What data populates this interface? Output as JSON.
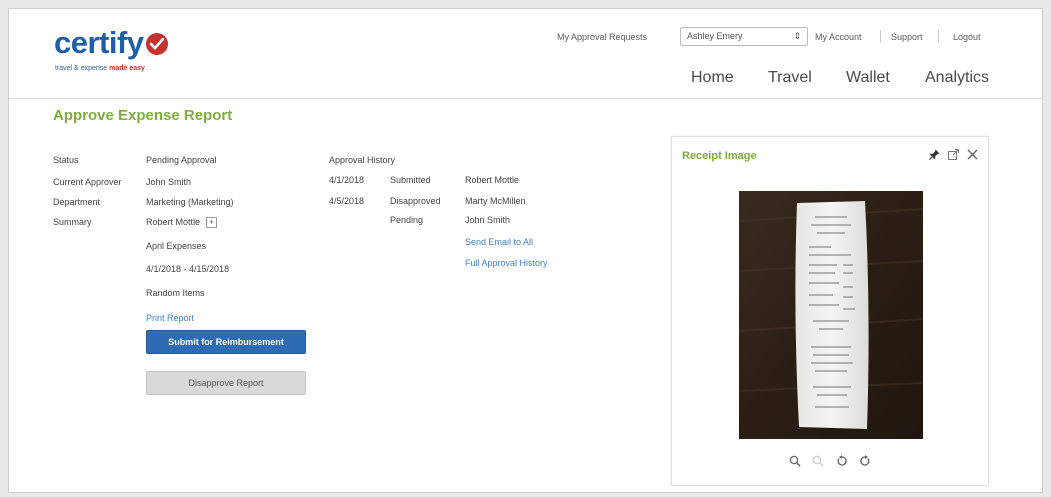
{
  "brand": {
    "name": "certify",
    "tagline_part1": "travel & expense",
    "tagline_part2": "made easy",
    "accent_color": "#c7322f",
    "logo_color": "#1f5fa8"
  },
  "header": {
    "my_approval_requests": "My Approval Requests",
    "user_selected": "Ashley Emery",
    "my_account": "My Account",
    "support": "Support",
    "logout": "Logout"
  },
  "nav": {
    "home": "Home",
    "travel": "Travel",
    "wallet": "Wallet",
    "analytics": "Analytics"
  },
  "page": {
    "title": "Approve Expense Report",
    "title_color": "#7cae3c"
  },
  "details": {
    "status_label": "Status",
    "status_value": "Pending Approval",
    "approver_label": "Current Approver",
    "approver_value": "John Smith",
    "department_label": "Department",
    "department_value": "Marketing (Marketing)",
    "summary_label": "Summary",
    "summary_value": "Robert Mottle",
    "report_name": "April Expenses",
    "date_range": "4/1/2018 - 4/15/2018",
    "note": "Random Items",
    "print_report": "Print Report"
  },
  "actions": {
    "submit": "Submit for Reimbursement",
    "disapprove": "Disapprove Report"
  },
  "history": {
    "title": "Approval History",
    "rows": [
      {
        "date": "4/1/2018",
        "status": "Submitted",
        "person": "Robert Mottle"
      },
      {
        "date": "4/5/2018",
        "status": "Disapproved",
        "person": "Marty McMillen"
      },
      {
        "date": "",
        "status": "Pending",
        "person": "John Smith"
      }
    ],
    "send_email": "Send Email to All",
    "full_history": "Full Approval History"
  },
  "receipt": {
    "title": "Receipt Image",
    "icons": [
      "pin-icon",
      "external-link-icon",
      "close-icon"
    ],
    "controls": [
      "zoom-in-icon",
      "zoom-out-icon",
      "rotate-left-icon",
      "rotate-right-icon"
    ]
  }
}
